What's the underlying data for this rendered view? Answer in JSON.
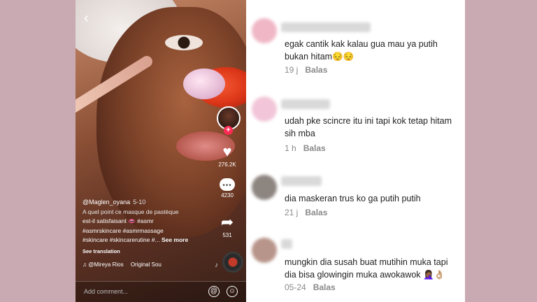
{
  "video": {
    "username": "@Maglen_oyana",
    "date": "5-10",
    "caption_lines": [
      "A quel point ce masque de pastèque",
      "est-il satisfaisant 👄 #asmr",
      "#asmrskincare #asmrmassage",
      "#skincare #skincarerutine #..."
    ],
    "see_more": "See more",
    "see_translation": "See translation",
    "music_artist": "@Mireya Rios",
    "music_title": "Original Sou",
    "likes": "276.2K",
    "comments_count": "4230",
    "shares": "531",
    "plus": "+",
    "add_comment_placeholder": "Add comment...",
    "at_symbol": "@",
    "emoji_symbol": "☺"
  },
  "comments": [
    {
      "text": "egak cantik kak kalau gua mau ya putih bukan hitam😔😔",
      "time": "19 j",
      "reply": "Balas",
      "avatar_color": "#f0b8c6"
    },
    {
      "text": "udah pke scincre itu ini tapi kok tetap hitam sih mba",
      "time": "1 h",
      "reply": "Balas",
      "avatar_color": "#f2c6d8"
    },
    {
      "text": "dia maskeran trus ko ga putih putih",
      "time": "21 j",
      "reply": "Balas",
      "avatar_color": "#8d8580"
    },
    {
      "text": "mungkin dia susah buat mutihin muka tapi dia bisa glowingin muka awokawok 🤦🏾‍♀️👌🏼",
      "time": "05-24",
      "reply": "Balas",
      "avatar_color": "#b8958a"
    }
  ],
  "colors": {
    "background": "#c9a9b2",
    "accent": "#fe2c55"
  }
}
